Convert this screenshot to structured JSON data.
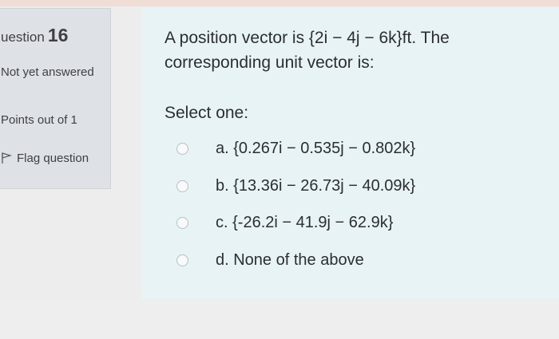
{
  "info": {
    "question_label": "uestion",
    "question_number": "16",
    "state": "Not yet answered",
    "grade": "Points out of 1",
    "flag_label": "Flag question"
  },
  "question": {
    "text": "A position vector is {2i − 4j − 6k}ft. The corresponding unit vector is:",
    "prompt": "Select one:",
    "options": [
      {
        "label": "a. {0.267i − 0.535j − 0.802k}"
      },
      {
        "label": "b. {13.36i − 26.73j − 40.09k}"
      },
      {
        "label": "c. {-26.2i − 41.9j − 62.9k}"
      },
      {
        "label": "d. None of the above"
      }
    ]
  },
  "colors": {
    "info_panel": "#dee2e6",
    "content_bg": "#e8f3f5",
    "text": "#2b2e33"
  }
}
